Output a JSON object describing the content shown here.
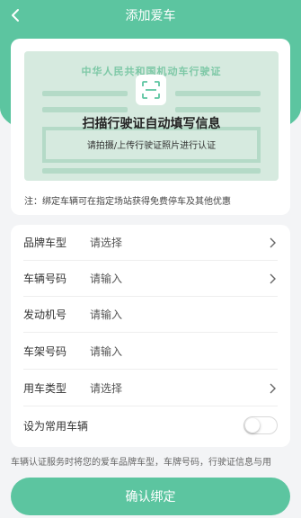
{
  "nav": {
    "title": "添加爱车",
    "back_icon": "chevron-left-icon"
  },
  "scan_card": {
    "license_title": "中华人民共和国机动车行驶证",
    "icon": "scan-icon",
    "main_text": "扫描行驶证自动填写信息",
    "sub_text": "请拍摄/上传行驶证照片进行认证",
    "note": "注：绑定车辆可在指定场站获得免费停车及其他优惠"
  },
  "form": {
    "rows": [
      {
        "label": "品牌车型",
        "value": "请选择",
        "has_chevron": true
      },
      {
        "label": "车辆号码",
        "value": "请输入",
        "has_chevron": true
      },
      {
        "label": "发动机号",
        "value": "请输入",
        "has_chevron": false
      },
      {
        "label": "车架号码",
        "value": "请输入",
        "has_chevron": false
      },
      {
        "label": "用车类型",
        "value": "请选择",
        "has_chevron": true
      }
    ],
    "default_label": "设为常用车辆",
    "default_on": false
  },
  "footer_text": "车辆认证服务时将您的爱车品牌车型，车牌号码，行驶证信息与用",
  "confirm_label": "确认绑定",
  "colors": {
    "accent": "#5cc5a0",
    "license_bg": "#d6eadf"
  }
}
